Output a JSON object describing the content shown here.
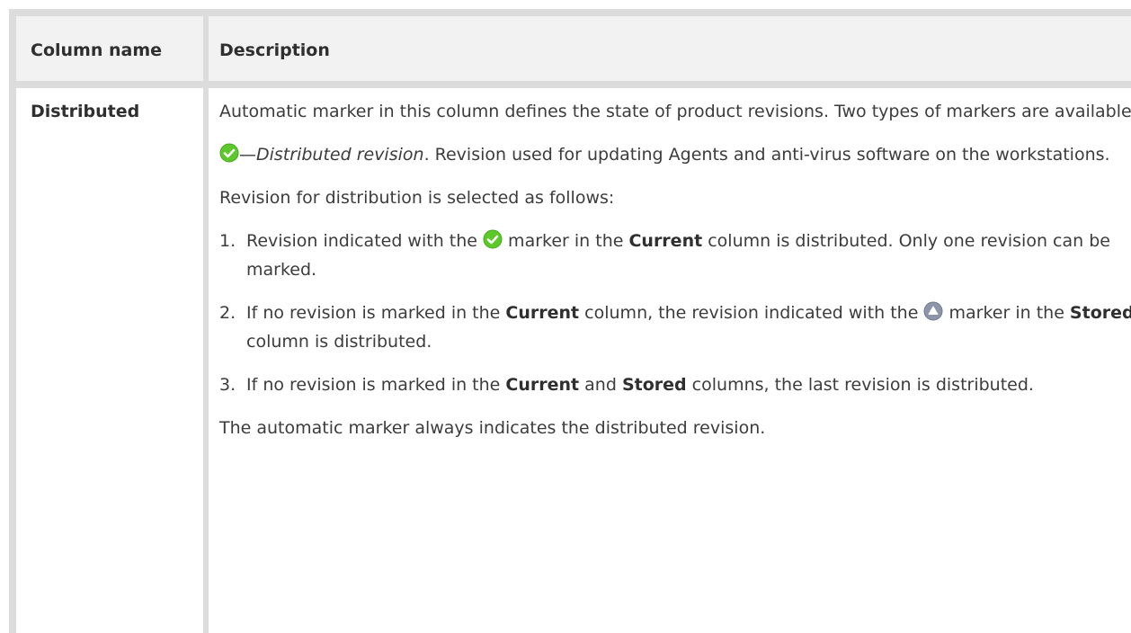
{
  "table": {
    "headers": [
      "Column name",
      "Description"
    ],
    "rows": [
      {
        "name": "Distributed",
        "intro": "Automatic marker in this column defines the state of product revisions. Two types of markers are available:",
        "marker_icon": "check-circle-icon",
        "marker_dash": "—",
        "marker_term": "Distributed revision",
        "marker_desc": ". Revision used for updating Agents and anti-virus software on the workstations.",
        "selection_intro": "Revision for distribution is selected as follows:",
        "steps": [
          {
            "num": "1.",
            "p1": "Revision indicated with the ",
            "icon": "check-circle-icon",
            "p2": " marker in the ",
            "bold1": "Current",
            "p3": " column is distributed. Only one revision can be marked."
          },
          {
            "num": "2.",
            "p1": "If no revision is marked in the ",
            "bold1": "Current",
            "p2": " column, the revision indicated with the ",
            "icon": "triangle-circle-icon",
            "p3": " marker in the ",
            "bold2": "Stored",
            "p4": " column is distributed."
          },
          {
            "num": "3.",
            "p1": "If no revision is marked in the ",
            "bold1": "Current",
            "p2": " and ",
            "bold2": "Stored",
            "p3": " columns, the last revision is distributed."
          }
        ],
        "closing": "The automatic marker always indicates the distributed revision."
      }
    ]
  },
  "colors": {
    "check_green": "#5cc82a",
    "stored_grey": "#8c96a8",
    "border": "#dcdcdc",
    "header_bg": "#f2f2f2"
  }
}
